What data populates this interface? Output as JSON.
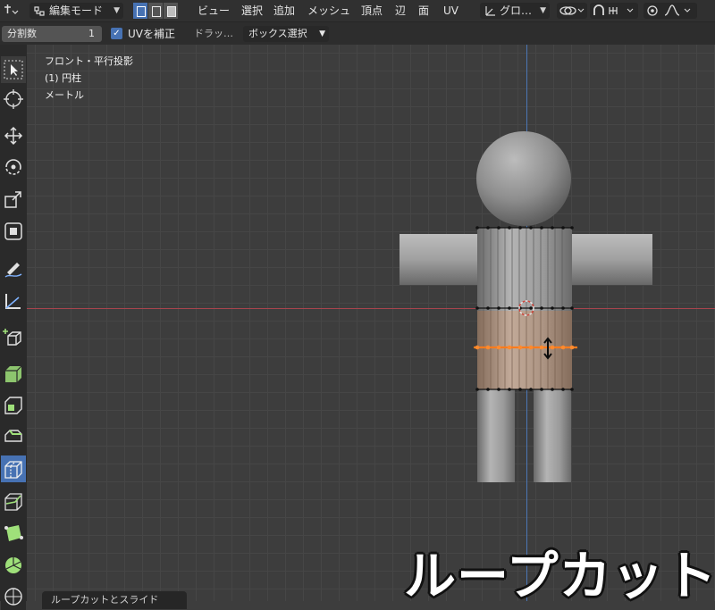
{
  "header": {
    "mode_label": "編集モード",
    "menus": [
      "ビュー",
      "選択",
      "追加",
      "メッシュ",
      "頂点",
      "辺",
      "面",
      "UV"
    ],
    "transform_orientation": "グロ…",
    "select_modes": [
      "vertex",
      "edge",
      "face"
    ],
    "active_select_mode": "vertex"
  },
  "tool_settings": {
    "cuts_label": "分割数",
    "cuts_value": "1",
    "uv_correct_label": "UVを補正",
    "uv_correct_checked": true,
    "drag_label": "ドラッ…",
    "box_select_label": "ボックス選択"
  },
  "viewport": {
    "view_name": "フロント・平行投影",
    "object_name": "(1) 円柱",
    "units": "メートル"
  },
  "tools": [
    {
      "name": "select-box-tool",
      "icon": "cursor-icon"
    },
    {
      "name": "cursor-tool",
      "icon": "crosshair-icon"
    },
    {
      "name": "move-tool",
      "icon": "move-arrows-icon"
    },
    {
      "name": "rotate-tool",
      "icon": "rotate-icon"
    },
    {
      "name": "scale-tool",
      "icon": "scale-icon"
    },
    {
      "name": "transform-tool",
      "icon": "transform-icon"
    },
    {
      "name": "annotate-tool",
      "icon": "pencil-icon"
    },
    {
      "name": "measure-tool",
      "icon": "ruler-icon"
    },
    {
      "name": "add-cube-tool",
      "icon": "add-cube-icon"
    },
    {
      "name": "extrude-tool",
      "icon": "extrude-icon"
    },
    {
      "name": "inset-tool",
      "icon": "inset-icon"
    },
    {
      "name": "bevel-tool",
      "icon": "bevel-icon"
    },
    {
      "name": "loop-cut-tool",
      "icon": "loop-cut-icon",
      "active": true
    },
    {
      "name": "knife-tool",
      "icon": "knife-icon"
    },
    {
      "name": "poly-build-tool",
      "icon": "poly-build-icon"
    },
    {
      "name": "spin-tool",
      "icon": "spin-icon"
    },
    {
      "name": "smooth-tool",
      "icon": "smooth-icon"
    }
  ],
  "operator_panel": {
    "label": "ループカットとスライド"
  },
  "caption": "ループカット",
  "colors": {
    "header_bg": "#303030",
    "viewport_bg": "#3d3d3d",
    "active_blue": "#4772b3",
    "x_axis": "#a8444d",
    "z_axis": "#4b76b5",
    "loop_cut_orange": "#ff7b1c"
  }
}
